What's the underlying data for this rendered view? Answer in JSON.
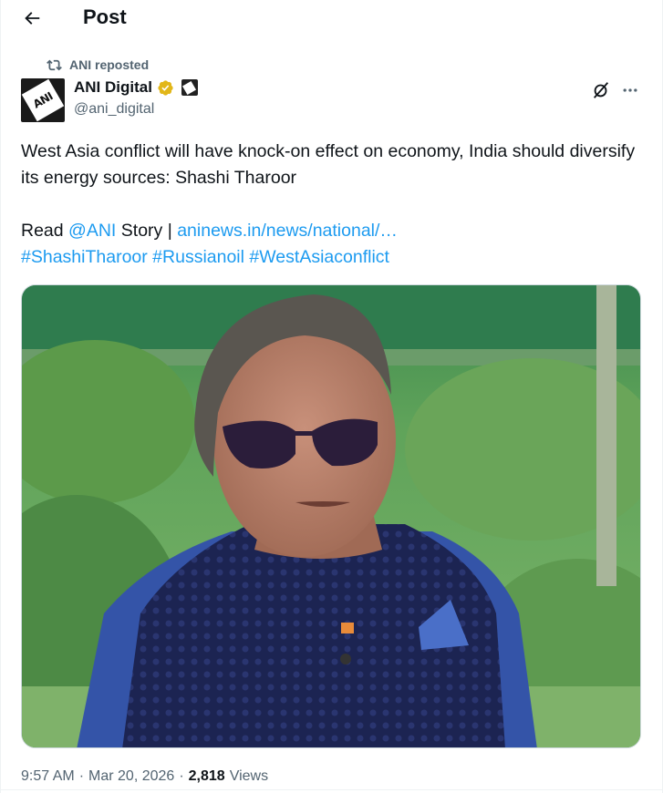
{
  "header": {
    "title": "Post",
    "back_icon": "arrow-left-icon"
  },
  "repost": {
    "label": "ANI reposted",
    "icon": "repost-icon"
  },
  "author": {
    "display_name": "ANI Digital",
    "handle": "@ani_digital",
    "verified_badge_color": "#e2b719",
    "avatar_text": "ANI"
  },
  "actions": {
    "grok_icon": "grok-icon",
    "more_icon": "more-icon"
  },
  "tweet": {
    "text": "West Asia conflict will have knock-on effect on economy, India should diversify its energy sources: Shashi Tharoor",
    "read_prefix": "Read ",
    "mention": "@ANI",
    "story_text": " Story | ",
    "link": "aninews.in/news/national/…",
    "hashtags": [
      "#ShashiTharoor",
      "#Russianoil",
      "#WestAsiaconflict"
    ]
  },
  "media": {
    "alt": "Photo of a man in dark sunglasses and a navy patterned Nehru jacket over a blue shirt, standing in front of garden foliage"
  },
  "meta": {
    "time": "9:57 AM",
    "separator": "·",
    "date": "Mar 20, 2026",
    "views_count": "2,818",
    "views_label": "Views"
  },
  "colors": {
    "link": "#1d9bf0",
    "secondary": "#536471",
    "primary": "#0f1419"
  }
}
